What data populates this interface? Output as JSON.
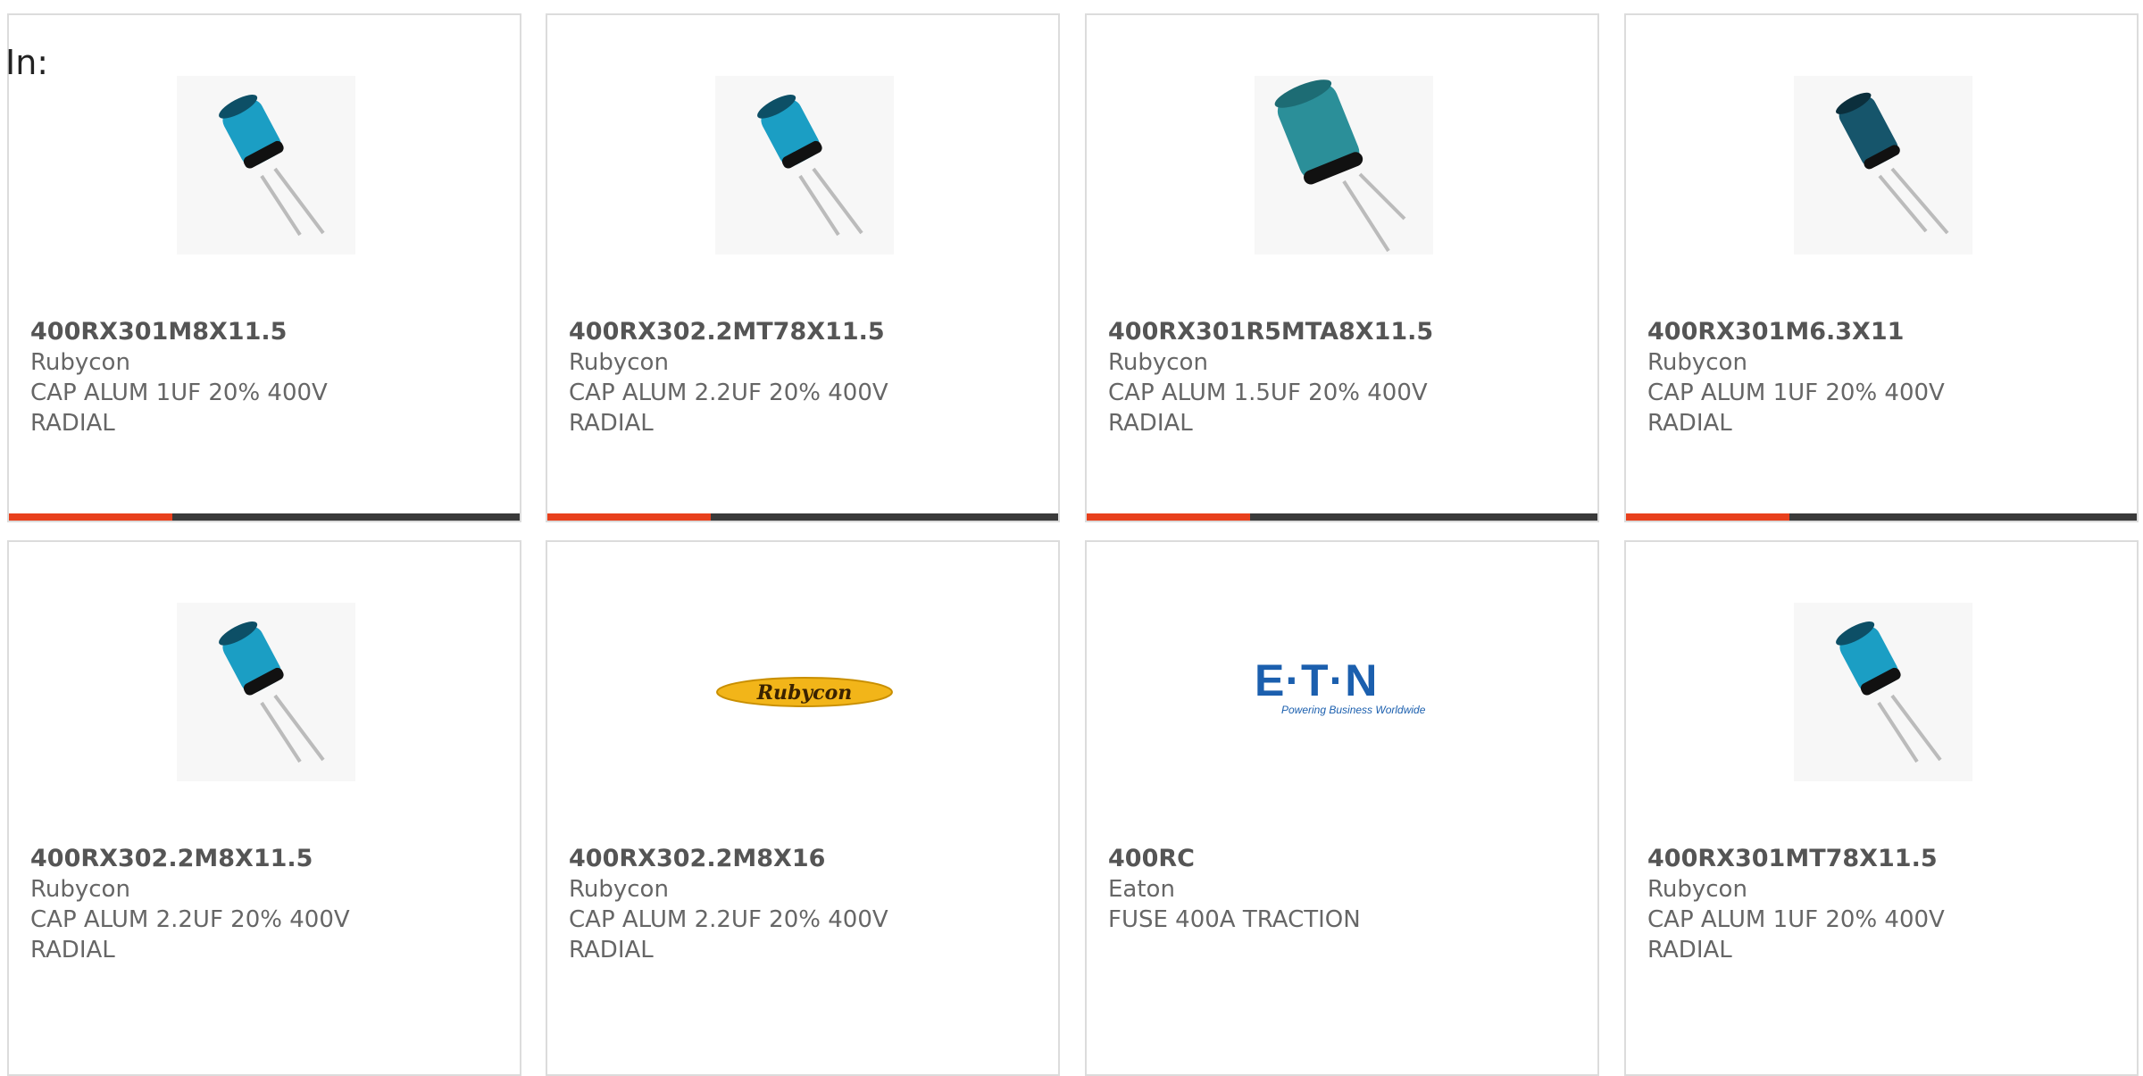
{
  "page": {
    "filter_label": "In:"
  },
  "colors": {
    "accent": "#e8401c",
    "bar": "#3a3a3a",
    "border": "#dcdcdc",
    "text": "#666666"
  },
  "products": [
    {
      "part_number": "400RX301M8X11.5",
      "manufacturer": "Rubycon",
      "desc1": "CAP ALUM 1UF 20% 400V",
      "desc2": "RADIAL",
      "image": "capacitor-blue-icon"
    },
    {
      "part_number": "400RX302.2MT78X11.5",
      "manufacturer": "Rubycon",
      "desc1": "CAP ALUM 2.2UF 20% 400V",
      "desc2": "RADIAL",
      "image": "capacitor-blue-icon"
    },
    {
      "part_number": "400RX301R5MTA8X11.5",
      "manufacturer": "Rubycon",
      "desc1": "CAP ALUM 1.5UF 20% 400V",
      "desc2": "RADIAL",
      "image": "capacitor-teal-icon"
    },
    {
      "part_number": "400RX301M6.3X11",
      "manufacturer": "Rubycon",
      "desc1": "CAP ALUM 1UF 20% 400V",
      "desc2": "RADIAL",
      "image": "capacitor-dark-icon"
    },
    {
      "part_number": "400RX302.2M8X11.5",
      "manufacturer": "Rubycon",
      "desc1": "CAP ALUM 2.2UF 20% 400V",
      "desc2": "RADIAL",
      "image": "capacitor-blue-icon"
    },
    {
      "part_number": "400RX302.2M8X16",
      "manufacturer": "Rubycon",
      "desc1": "CAP ALUM 2.2UF 20% 400V",
      "desc2": "RADIAL",
      "image": "rubycon-logo",
      "logo_text": "Rubycon"
    },
    {
      "part_number": "400RC",
      "manufacturer": "Eaton",
      "desc1": "FUSE 400A TRACTION",
      "desc2": "",
      "image": "eaton-logo",
      "logo_text": "E·T·N",
      "logo_tagline": "Powering Business Worldwide"
    },
    {
      "part_number": "400RX301MT78X11.5",
      "manufacturer": "Rubycon",
      "desc1": "CAP ALUM 1UF 20% 400V",
      "desc2": "RADIAL",
      "image": "capacitor-blue-icon"
    }
  ]
}
